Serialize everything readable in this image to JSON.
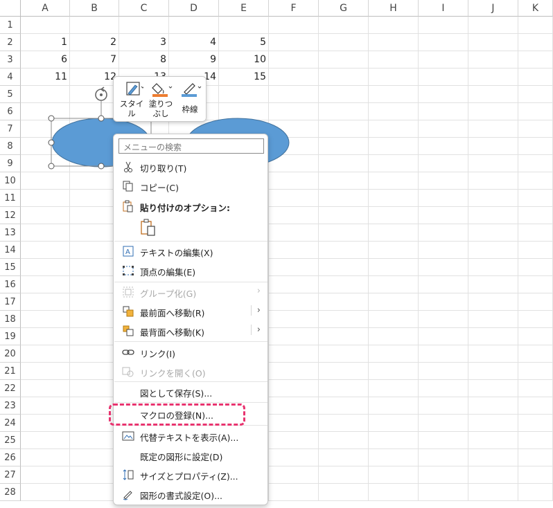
{
  "columns": [
    "A",
    "B",
    "C",
    "D",
    "E",
    "F",
    "G",
    "H",
    "I",
    "J",
    "K"
  ],
  "rows": [
    "1",
    "2",
    "3",
    "4",
    "5",
    "6",
    "7",
    "8",
    "9",
    "10",
    "11",
    "12",
    "13",
    "14",
    "15",
    "16",
    "17",
    "18",
    "19",
    "20",
    "21",
    "22",
    "23",
    "24",
    "25",
    "26",
    "27",
    "28"
  ],
  "cells": {
    "row2": [
      "1",
      "2",
      "3",
      "4",
      "5"
    ],
    "row3": [
      "6",
      "7",
      "8",
      "9",
      "10"
    ],
    "row4": [
      "11",
      "12",
      "13",
      "14",
      "15"
    ]
  },
  "mini_toolbar": {
    "style_label_1": "スタイ",
    "style_label_2": "ル",
    "fill_label_1": "塗りつ",
    "fill_label_2": "ぶし",
    "outline_label": "枠線",
    "fill_color": "#ed7d31",
    "outline_color": "#5b9bd5"
  },
  "shape_color": "#5b9bd5",
  "menu": {
    "search_placeholder": "メニューの検索",
    "cut": "切り取り(T)",
    "copy": "コピー(C)",
    "paste_options": "貼り付けのオプション:",
    "edit_text": "テキストの編集(X)",
    "edit_points": "頂点の編集(E)",
    "group": "グループ化(G)",
    "bring_front": "最前面へ移動(R)",
    "send_back": "最背面へ移動(K)",
    "link": "リンク(I)",
    "open_link": "リンクを開く(O)",
    "save_as_picture": "図として保存(S)...",
    "assign_macro": "マクロの登録(N)...",
    "alt_text": "代替テキストを表示(A)...",
    "set_default": "既定の図形に設定(D)",
    "size_properties": "サイズとプロパティ(Z)...",
    "format_shape": "図形の書式設定(O)...",
    "highlight_color": "#e8336f"
  }
}
